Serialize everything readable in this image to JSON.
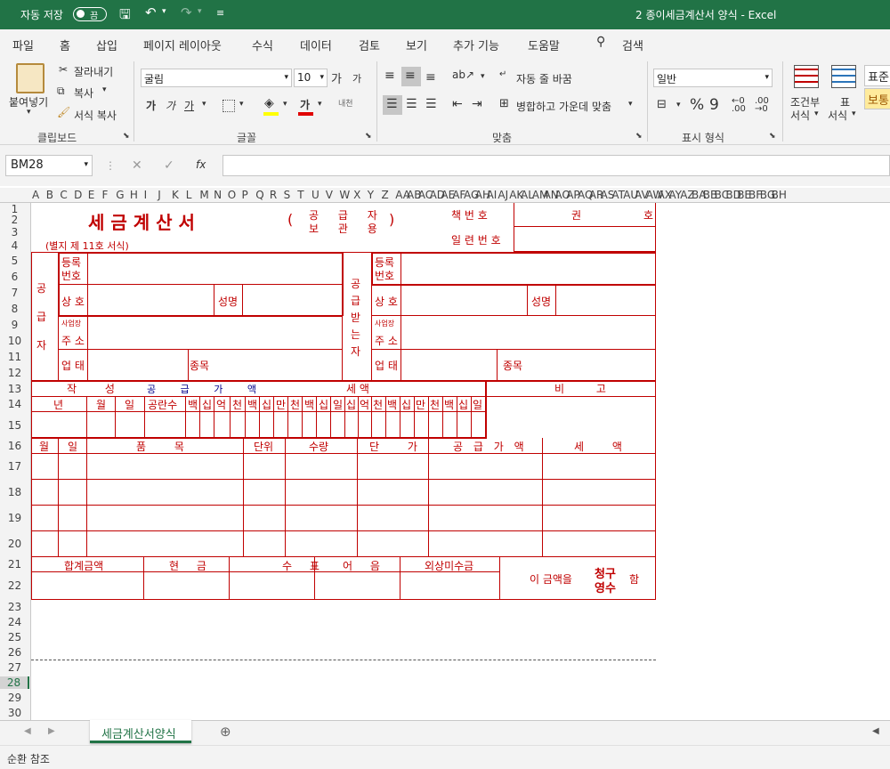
{
  "titlebar": {
    "autosave": "자동 저장",
    "toggle": "끔",
    "title": "2 종이세금계산서 양식  -  Excel"
  },
  "menu": [
    "파일",
    "홈",
    "삽입",
    "페이지 레이아웃",
    "수식",
    "데이터",
    "검토",
    "보기",
    "추가 기능",
    "도움말",
    "검색"
  ],
  "ribbon": {
    "paste": "붙여넣기",
    "cut": "잘라내기",
    "copy": "복사",
    "format_painter": "서식 복사",
    "clipboard": "클립보드",
    "font_name": "굴림",
    "font_size": "10",
    "font": "글꼴",
    "wrap": "자동 줄 바꿈",
    "merge": "병합하고 가운데 맞춤",
    "align": "맞춤",
    "num_format": "일반",
    "number": "표시 형식",
    "cond": "조건부",
    "cond2": "서식",
    "table": "표",
    "table2": "서식",
    "style1": "표준",
    "style2": "보통",
    "bold": "가",
    "italic": "가",
    "underline": "가",
    "font_color": "가",
    "grow": "가",
    "shrink": "가"
  },
  "formula": {
    "namebox": "BM28",
    "fx": "fx"
  },
  "columns": "A B C D E F G H I J K L M N O P Q R S T U V W X Y Z AA AB AC AD AE AF AG AH AI AJ AK AL AM AN AO AP AQ AR AS AT AU AV AW AX AY AZ BA BB BC BD BE BF BG BH",
  "rows": [
    "1",
    "2",
    "3",
    "4",
    "5",
    "6",
    "7",
    "8",
    "9",
    "10",
    "11",
    "12",
    "13",
    "14",
    "15",
    "16",
    "17",
    "18",
    "19",
    "20",
    "21",
    "22",
    "23",
    "24",
    "25",
    "26",
    "27",
    "28",
    "29",
    "30"
  ],
  "form": {
    "title": "세 금 계 산 서",
    "paren": "( 공 급 자 보 관 용 )",
    "copy_top": "공 급 자",
    "copy_bot": "보 관 용",
    "book": "책 번 호",
    "gwon": "권",
    "ho": "호",
    "serial": "일 련 번 호",
    "form_no": "(별지 제 11호 서식)",
    "supplier": "공 급 자",
    "receiver": "공 급 받 는 자",
    "reg": "등록",
    "reg2": "번호",
    "trade": "상 호",
    "name": "성명",
    "addr_small": "사업장",
    "addr": "주 소",
    "biz": "업 태",
    "item_type": "종목",
    "made": "작 성",
    "supply_amt": "공 급 가 액",
    "tax": "세 액",
    "note": "비 고",
    "year": "년",
    "month": "월",
    "day": "일",
    "blanks": "공란수",
    "digits_a": [
      "백",
      "십",
      "억",
      "천",
      "백",
      "십",
      "만",
      "천",
      "백",
      "십",
      "일"
    ],
    "digits_b": [
      "십",
      "억",
      "천",
      "백",
      "십",
      "만",
      "천",
      "백",
      "십",
      "일"
    ],
    "h_month": "월",
    "h_day": "일",
    "product": "품 목",
    "unit": "단위",
    "qty": "수량",
    "price": "단 가",
    "supply": "공 급 가 액",
    "tax2": "세 액",
    "total": "합계금액",
    "cash": "현 금",
    "check": "수 표",
    "bill": "어 음",
    "credit": "외상미수금",
    "amount_is": "이 금액을",
    "claim": "청구",
    "receipt": "영수",
    "ham": "함"
  },
  "tab": "세금계산서양식",
  "status": "순환 참조"
}
